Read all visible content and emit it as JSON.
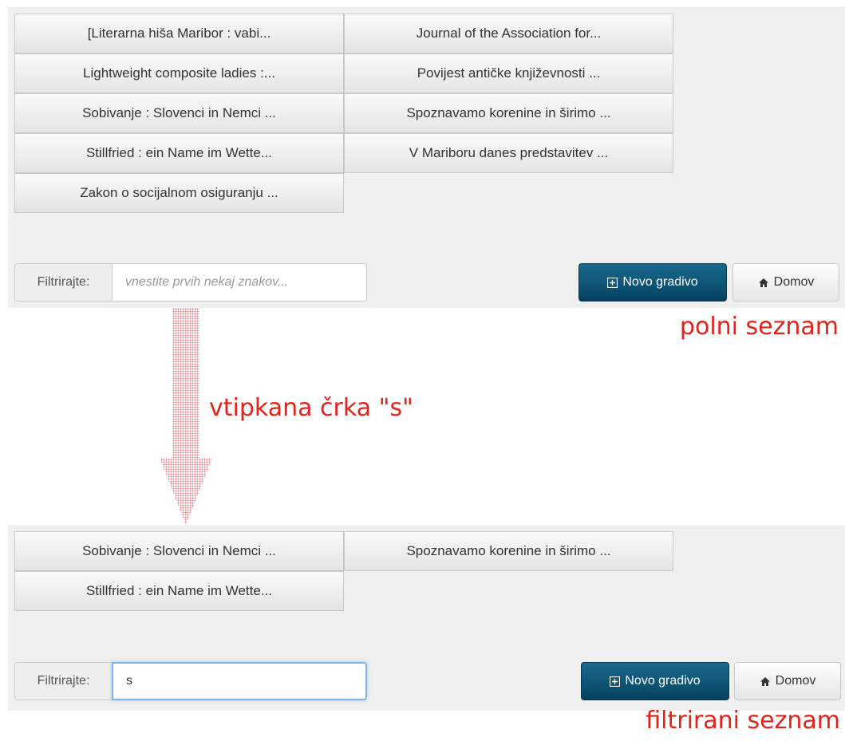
{
  "panel_full": {
    "items": [
      "[Literarna hiša Maribor : vabi...",
      "Journal of the Association for...",
      "Lightweight composite ladies :...",
      "Povijest antičke književnosti ...",
      "Sobivanje : Slovenci in Nemci ...",
      "Spoznavamo korenine in širimo ...",
      "Stillfried : ein Name im Wette...",
      "V Mariboru danes predstavitev ...",
      "Zakon o socijalnom osiguranju ..."
    ],
    "filter_label": "Filtrirajte:",
    "filter_placeholder": "vnestite prvih nekaj znakov...",
    "filter_value": "",
    "new_button_label": "Novo gradivo",
    "home_button_label": "Domov"
  },
  "panel_filtered": {
    "items": [
      "Sobivanje : Slovenci in Nemci ...",
      "Spoznavamo korenine in širimo ...",
      "Stillfried : ein Name im Wette..."
    ],
    "filter_label": "Filtrirajte:",
    "filter_value": "s",
    "new_button_label": "Novo gradivo",
    "home_button_label": "Domov"
  },
  "annotations": {
    "full_list": "polni seznam",
    "typed_letter": "vtipkana črka \"s\"",
    "filtered_list": "filtrirani seznam"
  },
  "colors": {
    "annotation": "#e2231a",
    "primary_button": "#0b4f6e",
    "panel_background": "#efefef"
  },
  "icons": {
    "new_button": "plus-square-icon",
    "home_button": "home-icon",
    "arrow": "down-arrow-icon"
  }
}
